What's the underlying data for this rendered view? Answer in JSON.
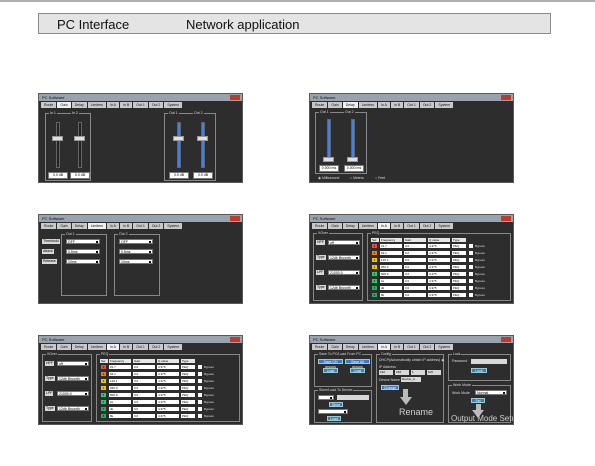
{
  "header": {
    "title_left": "PC Interface",
    "title_right": "Network application"
  },
  "window_title": "PC Software",
  "tabs": [
    "Route",
    "Gain",
    "Delay",
    "Limiters",
    "In A",
    "In B",
    "Out 1",
    "Out 2",
    "System"
  ],
  "gain": {
    "inputs": [
      {
        "label": "In 1",
        "value": "0.0 dB"
      },
      {
        "label": "In 2",
        "value": "0.0 dB"
      }
    ],
    "outputs": [
      {
        "label": "Out 1",
        "value": "0.0 dB"
      },
      {
        "label": "Out 2",
        "value": "0.0 dB"
      }
    ]
  },
  "delay": {
    "channels": [
      {
        "label": "Out 1",
        "value": "0.000 ms"
      },
      {
        "label": "Out 2",
        "value": "0.000 ms"
      }
    ],
    "units": [
      "Millisecond",
      "Meters",
      "Feet"
    ]
  },
  "limiters": {
    "rows": [
      "Threshold",
      "Attack",
      "Release"
    ],
    "groups": [
      {
        "label": "Out 1",
        "values": [
          "OFF",
          "0.5ms",
          "10ms"
        ]
      },
      {
        "label": "Out 2",
        "values": [
          "OFF",
          "0.5ms",
          "10ms"
        ]
      }
    ]
  },
  "eq": {
    "xover_label": "XOver",
    "peq_label": "PEQ",
    "xover_fields": [
      {
        "label": "HPF",
        "value": "off"
      },
      {
        "label": "Type",
        "value": "12db Bruwrth"
      },
      {
        "label": "LPF",
        "value": "21000.0"
      },
      {
        "label": "Type",
        "value": "12db Bruwrth"
      }
    ],
    "columns": [
      "Sel",
      "Frequency",
      "Gain",
      "Q value",
      "Type"
    ],
    "bands": [
      {
        "n": "1",
        "freq": "31.7",
        "gain": "0.0",
        "q": "4.375",
        "type": "PEQ",
        "color": "#e74c3c"
      },
      {
        "n": "2",
        "freq": "63.1",
        "gain": "0.0",
        "q": "4.375",
        "type": "PEQ",
        "color": "#e67e22"
      },
      {
        "n": "3",
        "freq": "125.1",
        "gain": "0.0",
        "q": "4.375",
        "type": "PEQ",
        "color": "#f1c40f"
      },
      {
        "n": "4",
        "freq": "250.0",
        "gain": "0.0",
        "q": "4.375",
        "type": "PEQ",
        "color": "#f1c40f"
      },
      {
        "n": "5",
        "freq": "500.0",
        "gain": "0.0",
        "q": "4.375",
        "type": "PEQ",
        "color": "#2ecc71"
      },
      {
        "n": "6",
        "freq": "1k",
        "gain": "0.0",
        "q": "4.375",
        "type": "PEQ",
        "color": "#2ecc71"
      },
      {
        "n": "7",
        "freq": "4k",
        "gain": "0.0",
        "q": "4.375",
        "type": "PEQ",
        "color": "#27ae60"
      },
      {
        "n": "8",
        "freq": "8k",
        "gain": "0.0",
        "q": "4.375",
        "type": "PEQ",
        "color": "#27ae60"
      }
    ],
    "bypass_label": "Bypass"
  },
  "system": {
    "save_group": "Save To PC/Load From PC",
    "save_btn1": "Save CH groups",
    "save_btn2": "Save All groups",
    "load_btn": "Load",
    "store_btn": "Store",
    "store_group": "Store/Load To Device",
    "device_name_label": "Device Name",
    "device_name_value": "Device_A",
    "config_group": "Config",
    "dhcp_label": "DHCP(Automatically obtain IP address)",
    "ip_label": "IP Address",
    "ip_parts": [
      "192",
      "168",
      "1",
      "100"
    ],
    "change_btn": "Change",
    "lock_group": "Lock",
    "password_label": "Password",
    "lock_btn": "Lock",
    "work_group": "Work Mode",
    "work_label": "Work Mode",
    "work_value": "Normal",
    "set_btn": "Set",
    "rename_text": "Rename",
    "output_mode_text": "Output Mode Setup"
  }
}
